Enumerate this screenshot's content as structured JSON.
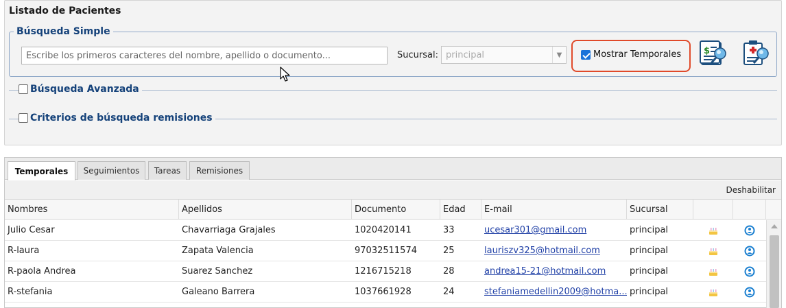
{
  "panel": {
    "title": "Listado de Pacientes",
    "simple_search": {
      "legend": "Búsqueda Simple",
      "search_placeholder": "Escribe los primeros caracteres del nombre, apellido o documento...",
      "sucursal_label": "Sucursal:",
      "sucursal_value": "principal",
      "mostrar_temporales_label": "Mostrar Temporales",
      "mostrar_temporales_checked": true
    },
    "advanced_search_label": "Búsqueda Avanzada",
    "referral_criteria_label": "Criterios de búsqueda remisiones"
  },
  "tabs": [
    {
      "label": "Temporales",
      "active": true
    },
    {
      "label": "Seguimientos",
      "active": false
    },
    {
      "label": "Tareas",
      "active": false
    },
    {
      "label": "Remisiones",
      "active": false
    }
  ],
  "toolbar": {
    "disable_label": "Deshabilitar"
  },
  "grid": {
    "headers": [
      "Nombres",
      "Apellidos",
      "Documento",
      "Edad",
      "E-mail",
      "Sucursal",
      "",
      ""
    ],
    "rows": [
      {
        "nombres": "Julio Cesar",
        "apellidos": "Chavarriaga Grajales",
        "documento": "1020420141",
        "edad": "33",
        "email": "ucesar301@gmail.com",
        "sucursal": "principal"
      },
      {
        "nombres": "R-laura",
        "apellidos": "Zapata Valencia",
        "documento": "97032511574",
        "edad": "25",
        "email": "lauriszv325@hotmail.com",
        "sucursal": "principal"
      },
      {
        "nombres": "R-paola Andrea",
        "apellidos": "Suarez Sanchez",
        "documento": "1216715218",
        "edad": "28",
        "email": "andrea15-21@hotmail.com",
        "sucursal": "principal"
      },
      {
        "nombres": "R-stefania",
        "apellidos": "Galeano Barrera",
        "documento": "1037661928",
        "edad": "24",
        "email": "stefaniamedellin2009@hotma...",
        "sucursal": "principal"
      }
    ]
  },
  "icons": {
    "billing": "billing-report-icon",
    "clinical": "clinical-record-icon",
    "birthday": "birthday-cake-icon",
    "convert": "convert-patient-icon"
  },
  "colors": {
    "accent_blue": "#15427a",
    "highlight_red": "#e04a2a",
    "link_blue": "#1f3fa6",
    "check_blue": "#1a73d9"
  }
}
